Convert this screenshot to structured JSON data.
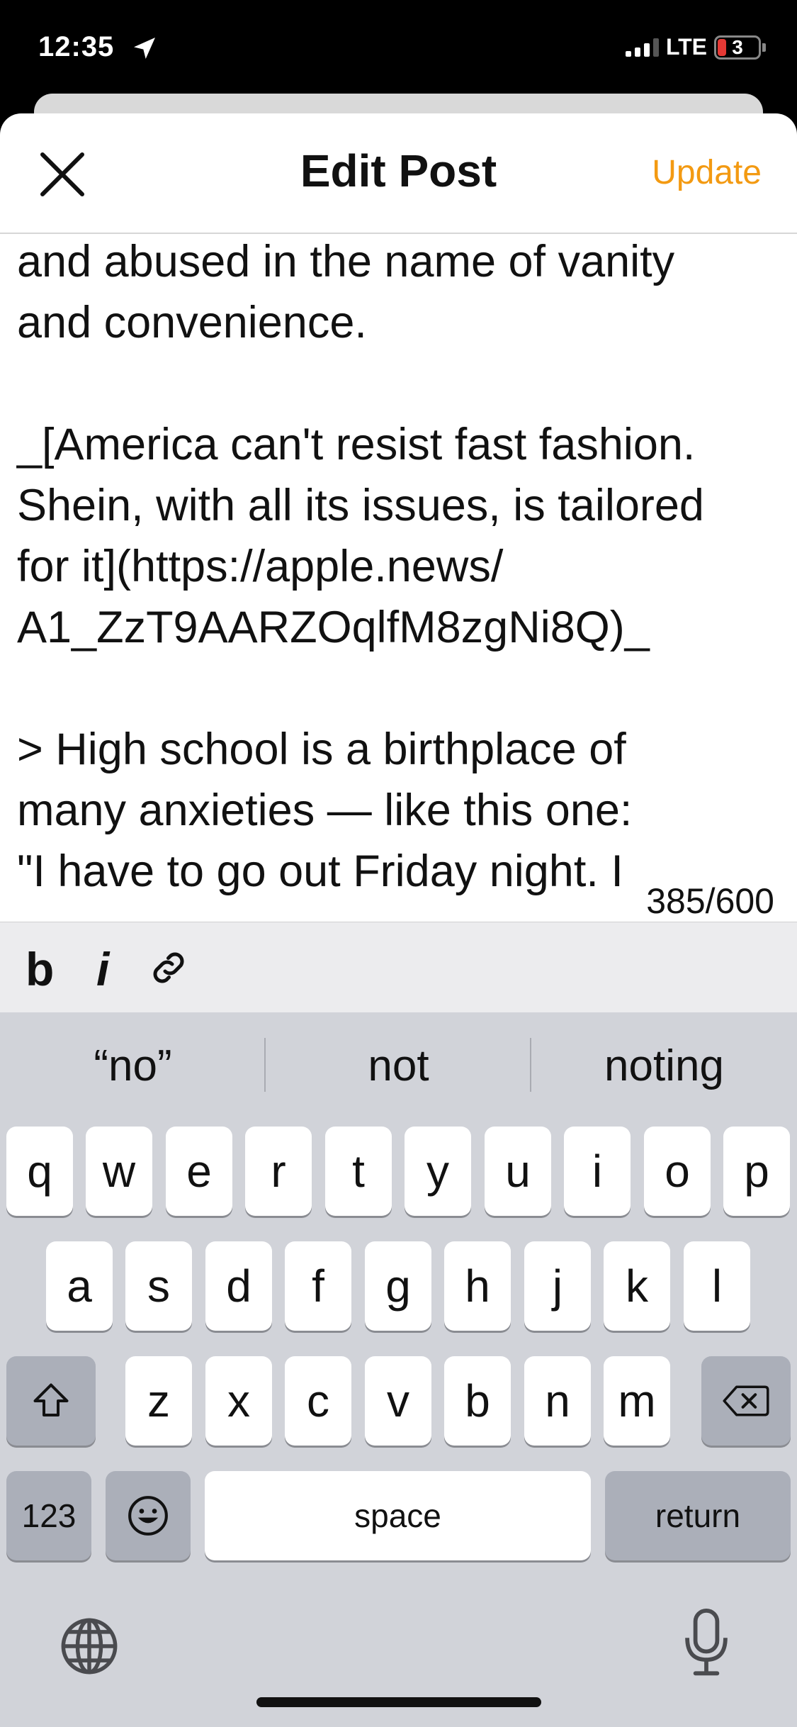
{
  "status_bar": {
    "time": "12:35",
    "network": "LTE",
    "battery": "3",
    "icons": [
      "location-arrow-icon",
      "signal-icon",
      "battery-icon"
    ]
  },
  "nav": {
    "title": "Edit Post",
    "update_label": "Update",
    "close_icon": "close-icon",
    "accent_color": "#f39a12"
  },
  "editor": {
    "text": "and abused in the name of vanity\nand convenience.\n\n_[America can't resist fast fashion.\nShein, with all its issues, is tailored\nfor it](https://apple.news/\nA1_ZzT9AARZOqlfM8zgNi8Q)_\n\n> High school is a birthplace of\nmany anxieties — like this one:\n\"I have to go out Friday night. I",
    "counter": "385/600"
  },
  "format_toolbar": {
    "bold": "b",
    "italic": "i",
    "link_icon": "link-icon"
  },
  "keyboard": {
    "suggestions": [
      "“no”",
      "not",
      "noting"
    ],
    "row1": [
      "q",
      "w",
      "e",
      "r",
      "t",
      "y",
      "u",
      "i",
      "o",
      "p"
    ],
    "row2": [
      "a",
      "s",
      "d",
      "f",
      "g",
      "h",
      "j",
      "k",
      "l"
    ],
    "row3": [
      "z",
      "x",
      "c",
      "v",
      "b",
      "n",
      "m"
    ],
    "numbers_label": "123",
    "space_label": "space",
    "return_label": "return",
    "icons": [
      "shift-icon",
      "backspace-icon",
      "emoji-icon",
      "globe-icon",
      "microphone-icon"
    ]
  }
}
